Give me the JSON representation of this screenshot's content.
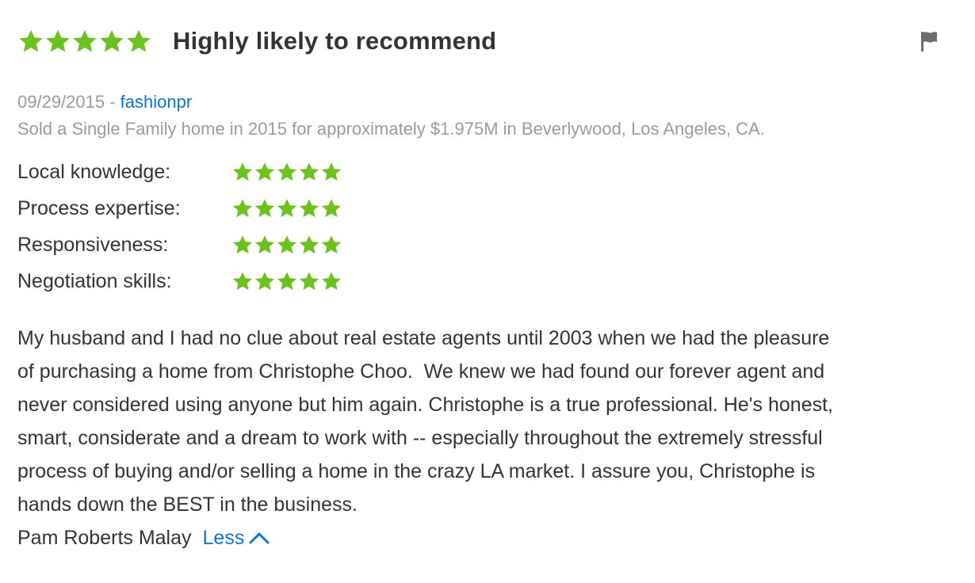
{
  "review": {
    "overall_rating": 5,
    "overall_rating_max": 5,
    "headline": "Highly likely to recommend",
    "date": "09/29/2015",
    "separator": " - ",
    "author": "fashionpr",
    "transaction": "Sold a Single Family home in 2015 for approximately $1.975M in Beverlywood, Los Angeles, CA.",
    "sub_ratings": [
      {
        "label": "Local knowledge:",
        "rating": 5
      },
      {
        "label": "Process expertise:",
        "rating": 5
      },
      {
        "label": "Responsiveness:",
        "rating": 5
      },
      {
        "label": "Negotiation skills:",
        "rating": 5
      }
    ],
    "body_lines": [
      "My husband and I had no clue about real estate agents until 2003 when we had the pleasure",
      "of purchasing a home from Christophe Choo.  We knew we had found our forever agent and",
      "never considered using anyone but him again. Christophe is a true professional. He's honest,",
      "smart, considerate and a dream to work with -- especially throughout the extremely stressful",
      "process of buying and/or selling a home in the crazy LA market. I assure you, Christophe is",
      "hands down the BEST in the business."
    ],
    "signature": "Pam Roberts Malay",
    "less_label": "Less"
  },
  "icons": {
    "star": "star-icon",
    "flag": "flag-icon",
    "chevron": "chevron-up-icon"
  },
  "colors": {
    "star_green": "#6cc11f",
    "link_blue": "#0f73d6",
    "meta_gray": "#9b9b9b",
    "text": "#333333",
    "flag_gray": "#6b6b6b"
  }
}
